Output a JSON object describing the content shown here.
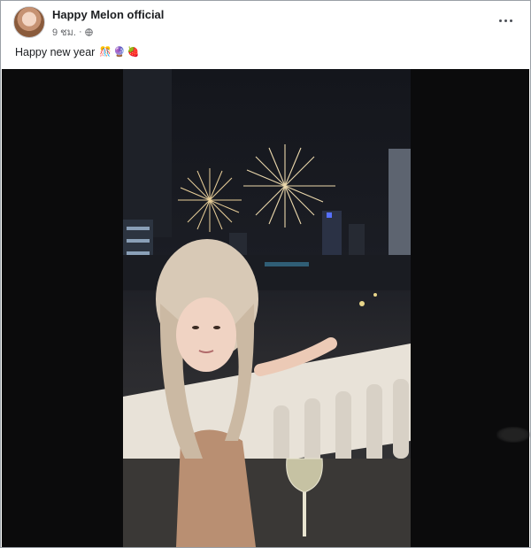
{
  "post": {
    "page_name": "Happy Melon official",
    "time": "9 ชม.",
    "separator": "·",
    "caption": "Happy new year",
    "emojis": [
      "🎊",
      "🔮",
      "🍓"
    ],
    "privacy_icon": "globe-icon",
    "more_icon": "more-options-icon"
  },
  "media": {
    "type": "video",
    "description_icon": "video-frame"
  },
  "colors": {
    "name_text": "#1c1e21",
    "meta_text": "#65676b",
    "media_bg": "#0b0b0c"
  }
}
